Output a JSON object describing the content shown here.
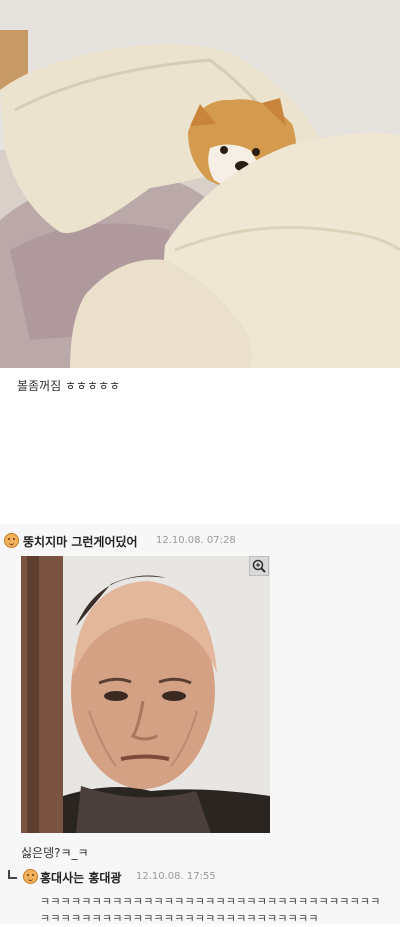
{
  "post": {
    "text": "볼좀꺼짐 ㅎㅎㅎㅎㅎ"
  },
  "comments": [
    {
      "nickname": "뚱치지마 그런게어딨어",
      "timestamp": "12.10.08. 07:28",
      "text": "싫은뎅?ㅋ_ㅋ"
    }
  ],
  "reply": {
    "nickname": "홍대사는 홍대광",
    "timestamp": "12.10.08. 17:55",
    "text": "ㅋㅋㅋㅋㅋㅋㅋㅋㅋㅋㅋㅋㅋㅋㅋㅋㅋㅋㅋㅋㅋㅋㅋㅋㅋㅋㅋㅋㅋㅋㅋㅋㅋㅋㅋㅋㅋㅋㅋㅋㅋㅋㅋㅋㅋㅋㅋㅋㅋㅋㅋㅋㅋㅋㅋㅋㅋㅋㅋㅋ"
  },
  "icons": {
    "avatar": "smiley-avatar-icon",
    "zoom": "zoom-in-icon",
    "reply": "reply-arrow-icon"
  }
}
